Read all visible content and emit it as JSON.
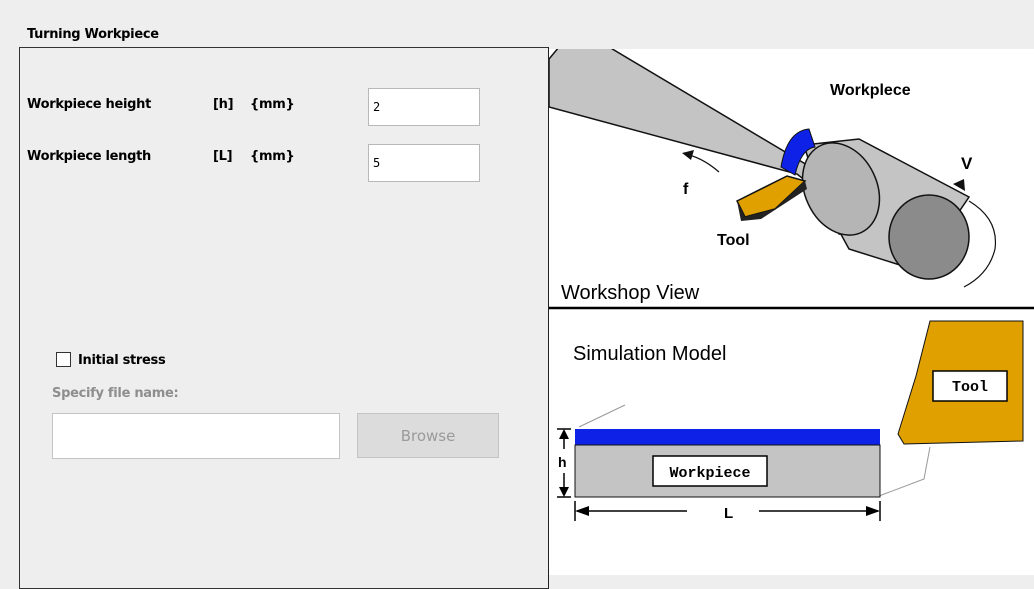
{
  "section": {
    "title": "Turning Workpiece"
  },
  "form": {
    "height_label": "Workpiece height",
    "height_symbol": "[h]",
    "height_unit": "{mm}",
    "height_value": "2",
    "length_label": "Workpiece length",
    "length_symbol": "[L]",
    "length_unit": "{mm}",
    "length_value": "5",
    "initial_stress_label": "Initial stress",
    "initial_stress_checked": false,
    "file_label": "Specify file name:",
    "file_value": "",
    "browse_label": "Browse"
  },
  "diagram": {
    "workpiece_top": "Workplece",
    "feed": "f",
    "velocity": "V",
    "tool_top": "Tool",
    "workshop_view": "Workshop View",
    "simulation_model": "Simulation Model",
    "tool_model": "Tool",
    "workpiece_model": "Workpiece",
    "h": "h",
    "L": "L"
  },
  "colors": {
    "cutting_layer": "#0d22e6",
    "tool": "#dfa000",
    "shaft": "#c4c4c4"
  }
}
